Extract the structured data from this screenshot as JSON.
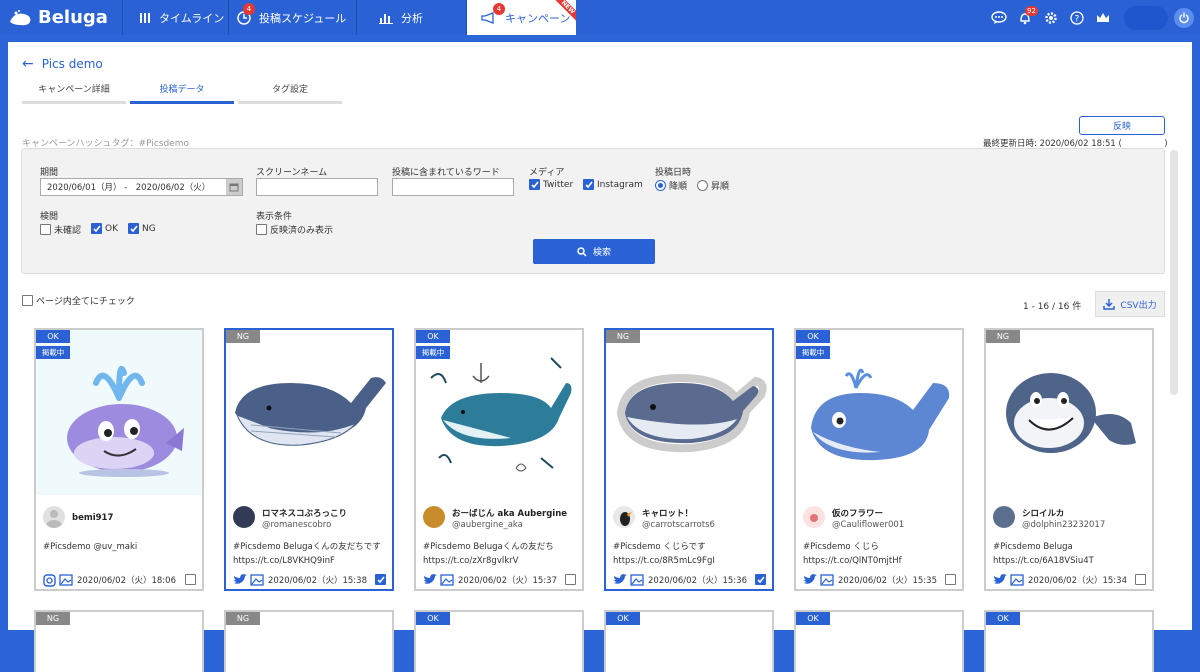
{
  "brand": "Beluga",
  "nav": [
    {
      "label": "タイムライン",
      "badge": ""
    },
    {
      "label": "投稿スケジュール",
      "badge": "4"
    },
    {
      "label": "分析",
      "badge": ""
    },
    {
      "label": "キャンペーン",
      "badge": "4",
      "ribbon": "NEW"
    }
  ],
  "notif_count": "92",
  "page": {
    "title": "Pics demo",
    "tabs": [
      "キャンペーン詳細",
      "投稿データ",
      "タグ設定"
    ],
    "hashtag": "キャンペーンハッシュタグ：#Picsdemo",
    "reflect": "反映",
    "updated": "最終更新日時: 2020/06/02 18:51 (　　　　　)"
  },
  "filter": {
    "period_label": "期間",
    "period_value": "2020/06/01（月） -　2020/06/02（火）",
    "screen_label": "スクリーンネーム",
    "word_label": "投稿に含まれているワード",
    "media_label": "メディア",
    "media": [
      {
        "label": "Twitter"
      },
      {
        "label": "Instagram"
      }
    ],
    "date_label": "投稿日時",
    "order": [
      {
        "label": "降順"
      },
      {
        "label": "昇順"
      }
    ],
    "review_label": "検閲",
    "review": [
      {
        "label": "未確認"
      },
      {
        "label": "OK"
      },
      {
        "label": "NG"
      }
    ],
    "cond_label": "表示条件",
    "cond": "反映済のみ表示",
    "search": "検索"
  },
  "list": {
    "check_all": "ページ内全てにチェック",
    "count": "1 - 16 / 16 件",
    "csv": "CSV出力"
  },
  "cards": [
    {
      "status": "OK",
      "published": "掲載中",
      "name": "bemi917",
      "id": "",
      "text1": "#Picsdemo @uv_maki",
      "text2": "",
      "date": "2020/06/02（火）18:06",
      "source": "instagram",
      "checked": false,
      "selected": false
    },
    {
      "status": "NG",
      "published": "",
      "name": "ロマネスコぶろっこり",
      "id": "@romanescobro",
      "text1": "#Picsdemo Belugaくんの友だちです",
      "text2": " https://t.co/L8VKHQ9inF",
      "date": "2020/06/02（火）15:38",
      "source": "twitter",
      "checked": true,
      "selected": true
    },
    {
      "status": "OK",
      "published": "掲載中",
      "name": "おーばじん aka Aubergine",
      "id": "@aubergine_aka",
      "text1": "#Picsdemo Belugaくんの友だち",
      "text2": "https://t.co/zXr8gvlkrV",
      "date": "2020/06/02（火）15:37",
      "source": "twitter",
      "checked": false,
      "selected": false
    },
    {
      "status": "NG",
      "published": "",
      "name": "キャロット！",
      "id": "@carrotscarrots6",
      "text1": "#Picsdemo くじらです",
      "text2": "https://t.co/8R5mLc9FgI",
      "date": "2020/06/02（火）15:36",
      "source": "twitter",
      "checked": true,
      "selected": true
    },
    {
      "status": "OK",
      "published": "掲載中",
      "name": "仮のフラワー",
      "id": "@Cauliflower001",
      "text1": "#Picsdemo くじら",
      "text2": "https://t.co/QlNT0mjtHf",
      "date": "2020/06/02（火）15:35",
      "source": "twitter",
      "checked": false,
      "selected": false
    },
    {
      "status": "NG",
      "published": "",
      "name": "シロイルカ",
      "id": "@dolphin23232017",
      "text1": "#Picsdemo Beluga",
      "text2": "https://t.co/6A18VSiu4T",
      "date": "2020/06/02（火）15:34",
      "source": "twitter",
      "checked": false,
      "selected": false
    }
  ],
  "row2_status": [
    "NG",
    "NG",
    "OK",
    "OK",
    "OK",
    "OK"
  ]
}
